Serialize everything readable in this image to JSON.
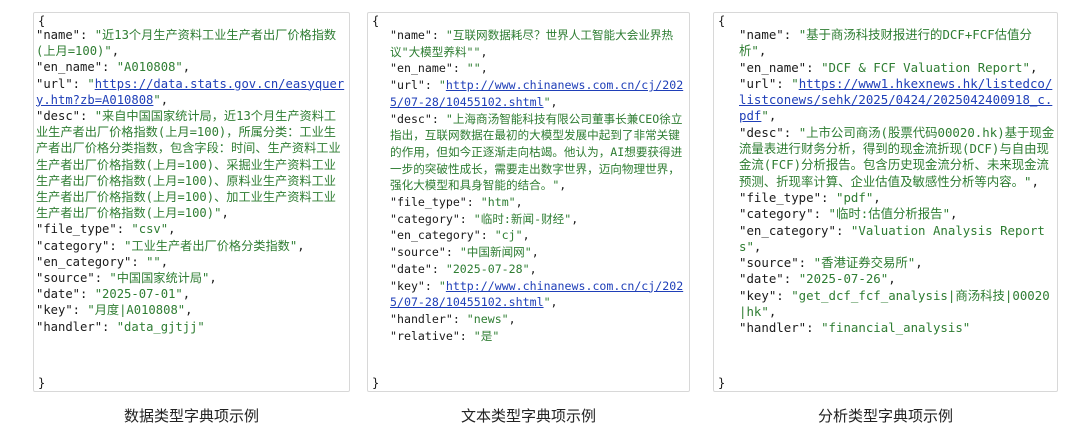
{
  "panels": [
    {
      "name": "近13个月生产资料工业生产者出厂价格指数(上月=100)",
      "en_name": "A010808",
      "url": "https://data.stats.gov.cn/easyquery.htm?zb=A010808",
      "desc": "来自中国国家统计局，近13个月生产资料工业生产者出厂价格指数(上月=100)，所属分类：工业生产者出厂价格分类指数，包含字段：时间、生产资料工业生产者出厂价格指数(上月=100)、采掘业生产资料工业生产者出厂价格指数(上月=100)、原料业生产资料工业生产者出厂价格指数(上月=100)、加工业生产资料工业生产者出厂价格指数(上月=100)",
      "file_type": "csv",
      "category": "工业生产者出厂价格分类指数",
      "en_category": "",
      "source": "中国国家统计局",
      "date": "2025-07-01",
      "key": "月度|A010808",
      "handler": "data_gjtjj"
    },
    {
      "name": "互联网数据耗尽？世界人工智能大会业界热议\"大模型养料\"",
      "en_name": "",
      "url": "http://www.chinanews.com.cn/cj/2025/07-28/10455102.shtml",
      "desc": "上海商汤智能科技有限公司董事长兼CEO徐立指出，互联网数据在最初的大模型发展中起到了非常关键的作用，但如今正逐渐走向枯竭。他认为，AI想要获得进一步的突破性成长，需要走出数字世界，迈向物理世界，强化大模型和具身智能的结合。",
      "file_type": "htm",
      "category": "临时:新闻-财经",
      "en_category": "cj",
      "source": "中国新闻网",
      "date": "2025-07-28",
      "key": "http://www.chinanews.com.cn/cj/2025/07-28/10455102.shtml",
      "handler": "news",
      "relative": "是"
    },
    {
      "name": "基于商汤科技财报进行的DCF+FCF估值分析",
      "en_name": "DCF & FCF Valuation Report",
      "url": "https://www1.hkexnews.hk/listedco/listconews/sehk/2025/0424/2025042400918_c.pdf",
      "desc": "上市公司商汤(股票代码00020.hk)基于现金流量表进行财务分析，得到的现金流折现(DCF)与自由现金流(FCF)分析报告。包含历史现金流分析、未来现金流预测、折现率计算、企业估值及敏感性分析等内容。",
      "file_type": "pdf",
      "category": "临时:估值分析报告",
      "en_category": "Valuation Analysis Reports",
      "source": "香港证券交易所",
      "date": "2025-07-26",
      "key": "get_dcf_fcf_analysis|商汤科技|00020|hk",
      "handler": "financial_analysis"
    }
  ],
  "captions": [
    "数据类型字典项示例",
    "文本类型字典项示例",
    "分析类型字典项示例"
  ],
  "colors": {
    "string": "#2e7d32",
    "url": "#1f3fb8",
    "key": "#1a1a1a",
    "border": "#d8d8d8"
  }
}
